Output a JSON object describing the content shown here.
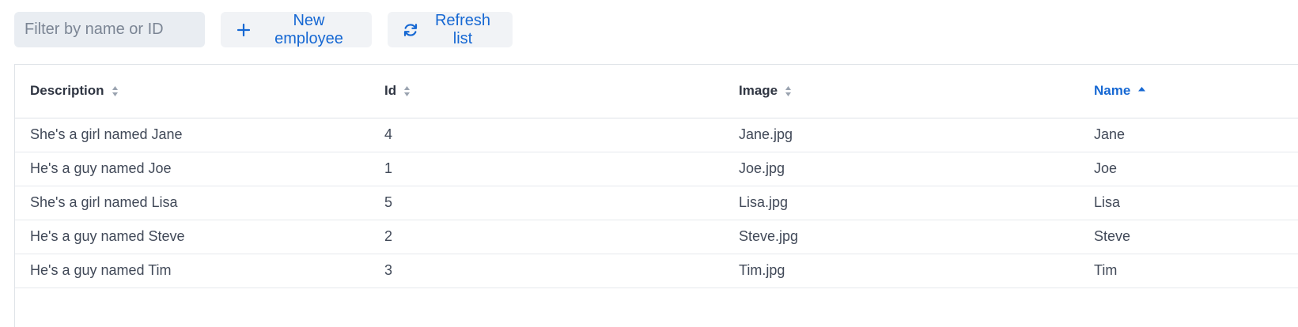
{
  "toolbar": {
    "filter_placeholder": "Filter by name or ID",
    "filter_value": "",
    "new_label": "New employee",
    "refresh_label": "Refresh list"
  },
  "table": {
    "columns": [
      {
        "label": "Description",
        "sort": "none"
      },
      {
        "label": "Id",
        "sort": "none"
      },
      {
        "label": "Image",
        "sort": "none"
      },
      {
        "label": "Name",
        "sort": "ascending"
      }
    ],
    "rows": [
      [
        "She's a girl named Jane",
        "4",
        "Jane.jpg",
        "Jane"
      ],
      [
        "He's a guy named Joe",
        "1",
        "Joe.jpg",
        "Joe"
      ],
      [
        "She's a girl named Lisa",
        "5",
        "Lisa.jpg",
        "Lisa"
      ],
      [
        "He's a guy named Steve",
        "2",
        "Steve.jpg",
        "Steve"
      ],
      [
        "He's a guy named Tim",
        "3",
        "Tim.jpg",
        "Tim"
      ]
    ]
  },
  "colors": {
    "accent": "#1668d3",
    "input_bg": "#e9edf2",
    "button_bg": "#f1f3f6",
    "border": "#dfe3e8"
  },
  "icons": {
    "new": "plus-icon",
    "refresh": "refresh-icon",
    "sortable": "sort-both-icon",
    "sorted_asc": "sort-up-icon"
  }
}
